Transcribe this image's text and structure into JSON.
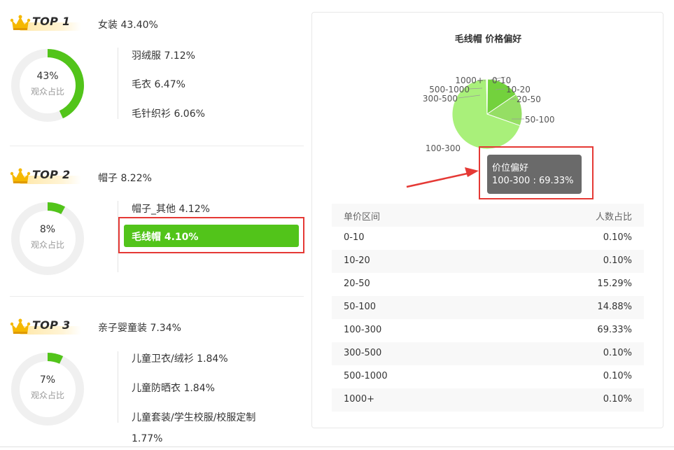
{
  "categories": [
    {
      "badge": "TOP 1",
      "title": "女装 43.40%",
      "donut_percent": 43,
      "donut_label": "43%",
      "donut_caption": "观众占比",
      "subs": [
        "羽绒服 7.12%",
        "毛衣 6.47%",
        "毛针织衫 6.06%"
      ]
    },
    {
      "badge": "TOP 2",
      "title": "帽子 8.22%",
      "donut_percent": 8,
      "donut_label": "8%",
      "donut_caption": "观众占比",
      "subs": [
        "帽子_其他 4.12%",
        "毛线帽 4.10%"
      ],
      "active_sub": "毛线帽 4.10%"
    },
    {
      "badge": "TOP 3",
      "title": "亲子婴童装 7.34%",
      "donut_percent": 7,
      "donut_label": "7%",
      "donut_caption": "观众占比",
      "subs": [
        "儿童卫衣/绒衫 1.84%",
        "儿童防晒衣 1.84%",
        "儿童套装/学生校服/校服定制",
        "1.77%"
      ]
    }
  ],
  "panel": {
    "title": "毛线帽 价格偏好",
    "tooltip": {
      "title": "价位偏好",
      "value": "100-300 : 69.33%"
    },
    "table": {
      "headers": [
        "单价区间",
        "人数占比"
      ],
      "rows": [
        [
          "0-10",
          "0.10%"
        ],
        [
          "10-20",
          "0.10%"
        ],
        [
          "20-50",
          "15.29%"
        ],
        [
          "50-100",
          "14.88%"
        ],
        [
          "100-300",
          "69.33%"
        ],
        [
          "300-500",
          "0.10%"
        ],
        [
          "500-1000",
          "0.10%"
        ],
        [
          "1000+",
          "0.10%"
        ]
      ]
    }
  },
  "chart_data": {
    "type": "pie",
    "title": "毛线帽 价格偏好",
    "labels": [
      "0-10",
      "10-20",
      "20-50",
      "50-100",
      "100-300",
      "300-500",
      "500-1000",
      "1000+"
    ],
    "values": [
      0.1,
      0.1,
      15.29,
      14.88,
      69.33,
      0.1,
      0.1,
      0.1
    ],
    "highlighted": "100-300",
    "colors": [
      "#52c41a",
      "#52c41a",
      "#73d13d",
      "#95de64",
      "#a9f07a",
      "#52c41a",
      "#52c41a",
      "#52c41a"
    ]
  },
  "colors": {
    "accent": "#52c41a",
    "donut_track": "#f0f0f0",
    "highlight_box": "#e53935"
  }
}
